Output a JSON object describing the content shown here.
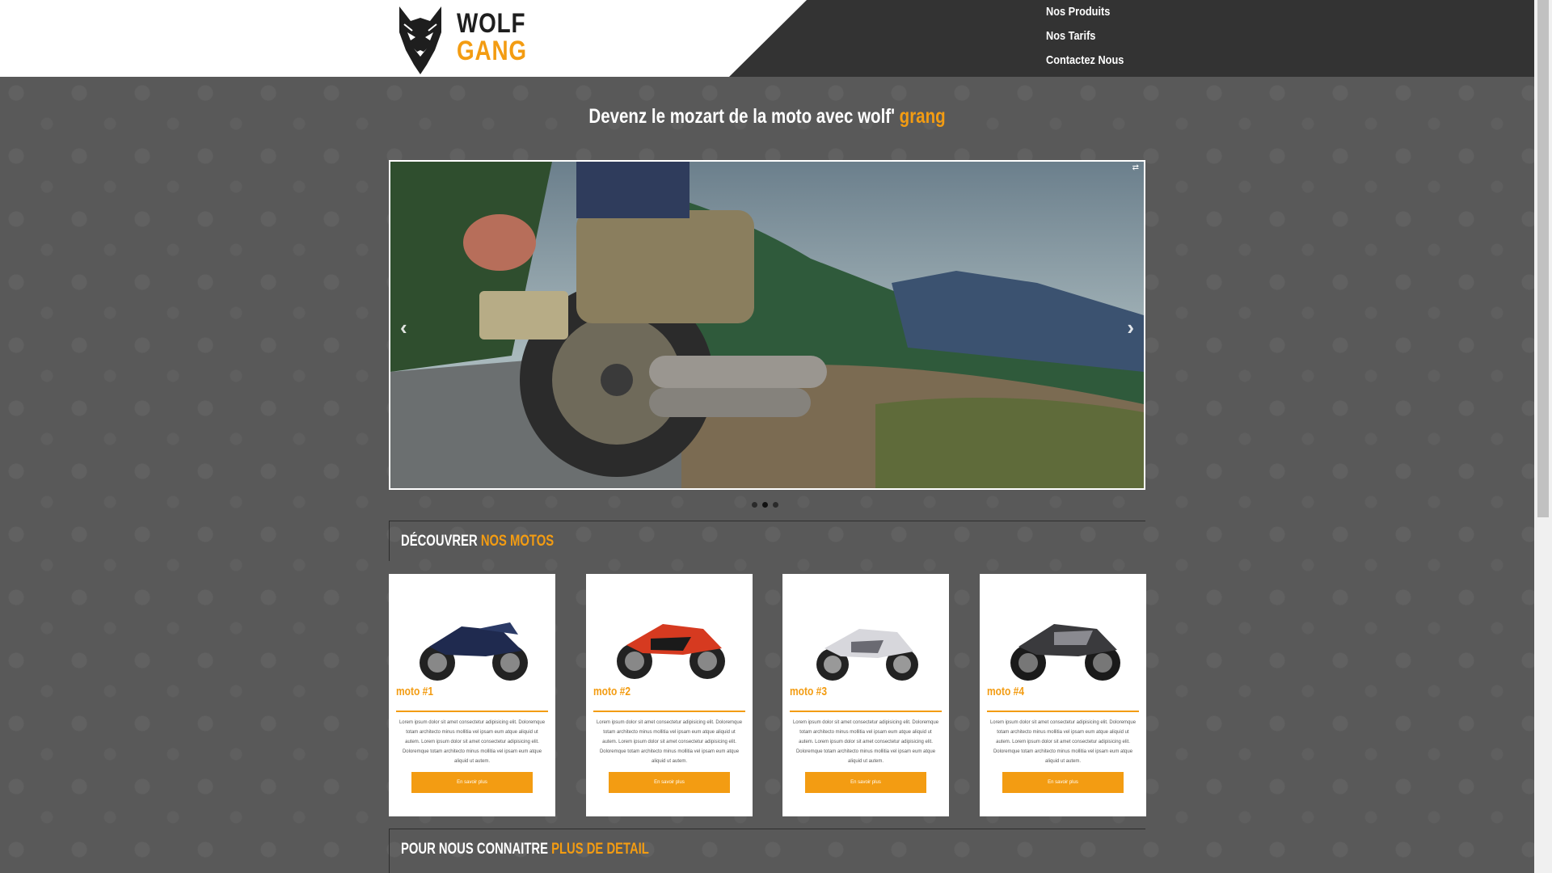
{
  "brand": {
    "line1": "WOLF",
    "line2": "GANG",
    "accent_color": "#f39c12"
  },
  "nav": {
    "items": [
      "Nos Produits",
      "Nos Tarifs",
      "Contactez Nous"
    ]
  },
  "hero": {
    "title": "Devenz le mozart de la moto avec wolf'",
    "title_accent": "grang"
  },
  "carousel": {
    "slide_count": 3,
    "active_slide": 2,
    "corner_glyph": "⇄"
  },
  "sections": {
    "motos": {
      "label": "Découvrer",
      "accent": "nos motos"
    },
    "about": {
      "label": "Pour nous connaitre",
      "accent": "plus de detail"
    }
  },
  "cards": [
    {
      "title": "moto #1",
      "bike_color": "#1f2a4f",
      "description": "Lorem ipsum dolor sit amet consectetur adipisicing elit. Doloremque totam architecto minus mollitia vel ipsam eum atque aliquid ut autem. Lorem ipsum dolor sit amet consectetur adipisicing elit. Doloremque totam architecto minus mollitia vel ipsam eum atque aliquid ut autem.",
      "button": "En savoir plus"
    },
    {
      "title": "moto #2",
      "bike_color": "#d63a20",
      "description": "Lorem ipsum dolor sit amet consectetur adipisicing elit. Doloremque totam architecto minus mollitia vel ipsam eum atque aliquid ut autem. Lorem ipsum dolor sit amet consectetur adipisicing elit. Doloremque totam architecto minus mollitia vel ipsam eum atque aliquid ut autem.",
      "button": "En savoir plus"
    },
    {
      "title": "moto #3",
      "bike_color": "#d7d7dc",
      "description": "Lorem ipsum dolor sit amet consectetur adipisicing elit. Doloremque totam architecto minus mollitia vel ipsam eum atque aliquid ut autem. Lorem ipsum dolor sit amet consectetur adipisicing elit. Doloremque totam architecto minus mollitia vel ipsam eum atque aliquid ut autem.",
      "button": "En savoir plus"
    },
    {
      "title": "moto #4",
      "bike_color": "#3a3a3d",
      "description": "Lorem ipsum dolor sit amet consectetur adipisicing elit. Doloremque totam architecto minus mollitia vel ipsam eum atque aliquid ut autem. Lorem ipsum dolor sit amet consectetur adipisicing elit. Doloremque totam architecto minus mollitia vel ipsam eum atque aliquid ut autem.",
      "button": "En savoir plus"
    }
  ]
}
